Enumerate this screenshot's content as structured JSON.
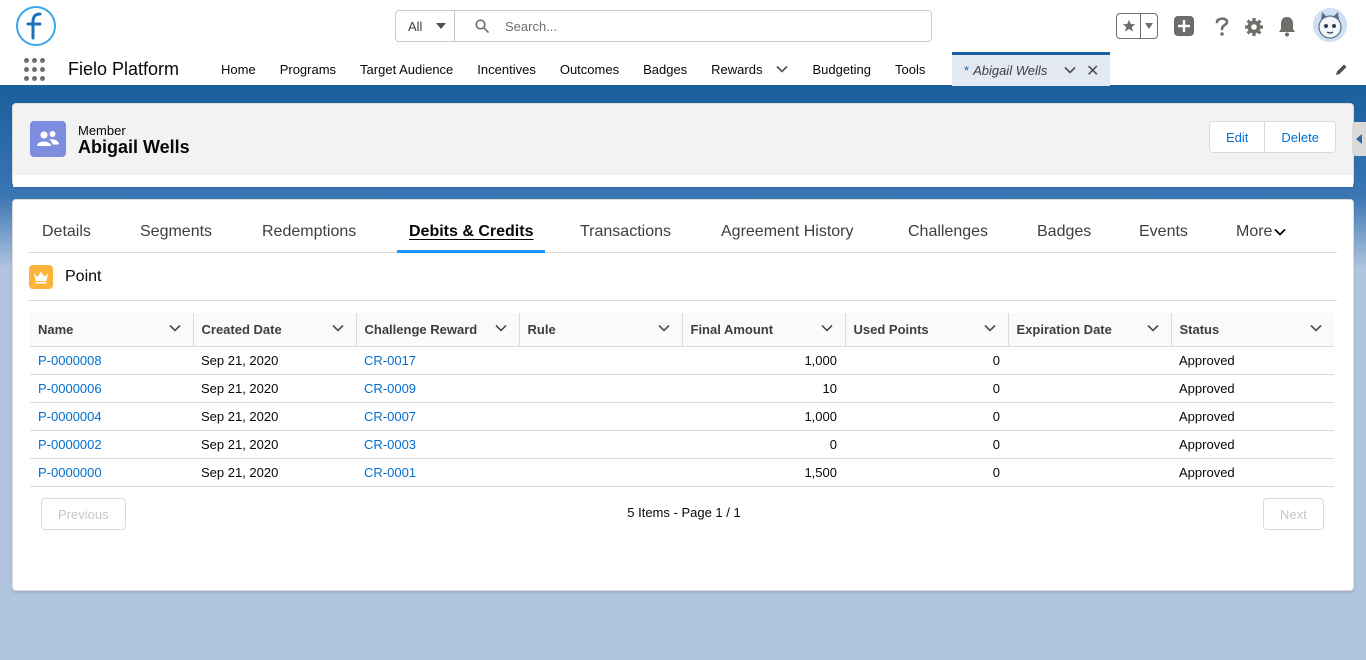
{
  "header": {
    "search_scope": "All",
    "search_placeholder": "Search..."
  },
  "nav": {
    "app_name": "Fielo Platform",
    "items": [
      {
        "label": "Home"
      },
      {
        "label": "Programs"
      },
      {
        "label": "Target Audience"
      },
      {
        "label": "Incentives"
      },
      {
        "label": "Outcomes"
      },
      {
        "label": "Badges"
      },
      {
        "label": "Rewards"
      },
      {
        "label": "Budgeting"
      },
      {
        "label": "Tools"
      }
    ],
    "active_tab": {
      "marker": "*",
      "label": "Abigail Wells"
    }
  },
  "record": {
    "type": "Member",
    "name": "Abigail Wells",
    "actions": [
      "Edit",
      "Delete"
    ]
  },
  "tabs": [
    "Details",
    "Segments",
    "Redemptions",
    "Debits & Credits",
    "Transactions",
    "Agreement History",
    "Challenges",
    "Badges",
    "Events",
    "More"
  ],
  "active_tab_index": 3,
  "related_list": {
    "title": "Point",
    "columns": [
      "Name",
      "Created Date",
      "Challenge Reward",
      "Rule",
      "Final Amount",
      "Used Points",
      "Expiration Date",
      "Status"
    ],
    "rows": [
      {
        "name": "P-0000008",
        "created": "Sep 21, 2020",
        "reward": "CR-0017",
        "rule": "",
        "final": "1,000",
        "used": "0",
        "expiration": "",
        "status": "Approved"
      },
      {
        "name": "P-0000006",
        "created": "Sep 21, 2020",
        "reward": "CR-0009",
        "rule": "",
        "final": "10",
        "used": "0",
        "expiration": "",
        "status": "Approved"
      },
      {
        "name": "P-0000004",
        "created": "Sep 21, 2020",
        "reward": "CR-0007",
        "rule": "",
        "final": "1,000",
        "used": "0",
        "expiration": "",
        "status": "Approved"
      },
      {
        "name": "P-0000002",
        "created": "Sep 21, 2020",
        "reward": "CR-0003",
        "rule": "",
        "final": "0",
        "used": "0",
        "expiration": "",
        "status": "Approved"
      },
      {
        "name": "P-0000000",
        "created": "Sep 21, 2020",
        "reward": "CR-0001",
        "rule": "",
        "final": "1,500",
        "used": "0",
        "expiration": "",
        "status": "Approved"
      }
    ],
    "pager": {
      "previous": "Previous",
      "info": "5 Items - Page 1 / 1",
      "next": "Next"
    }
  },
  "colors": {
    "brand": "#1b5f9e",
    "link": "#0070d2",
    "member_icon": "#7f8de1",
    "point_icon": "#fbb439"
  }
}
